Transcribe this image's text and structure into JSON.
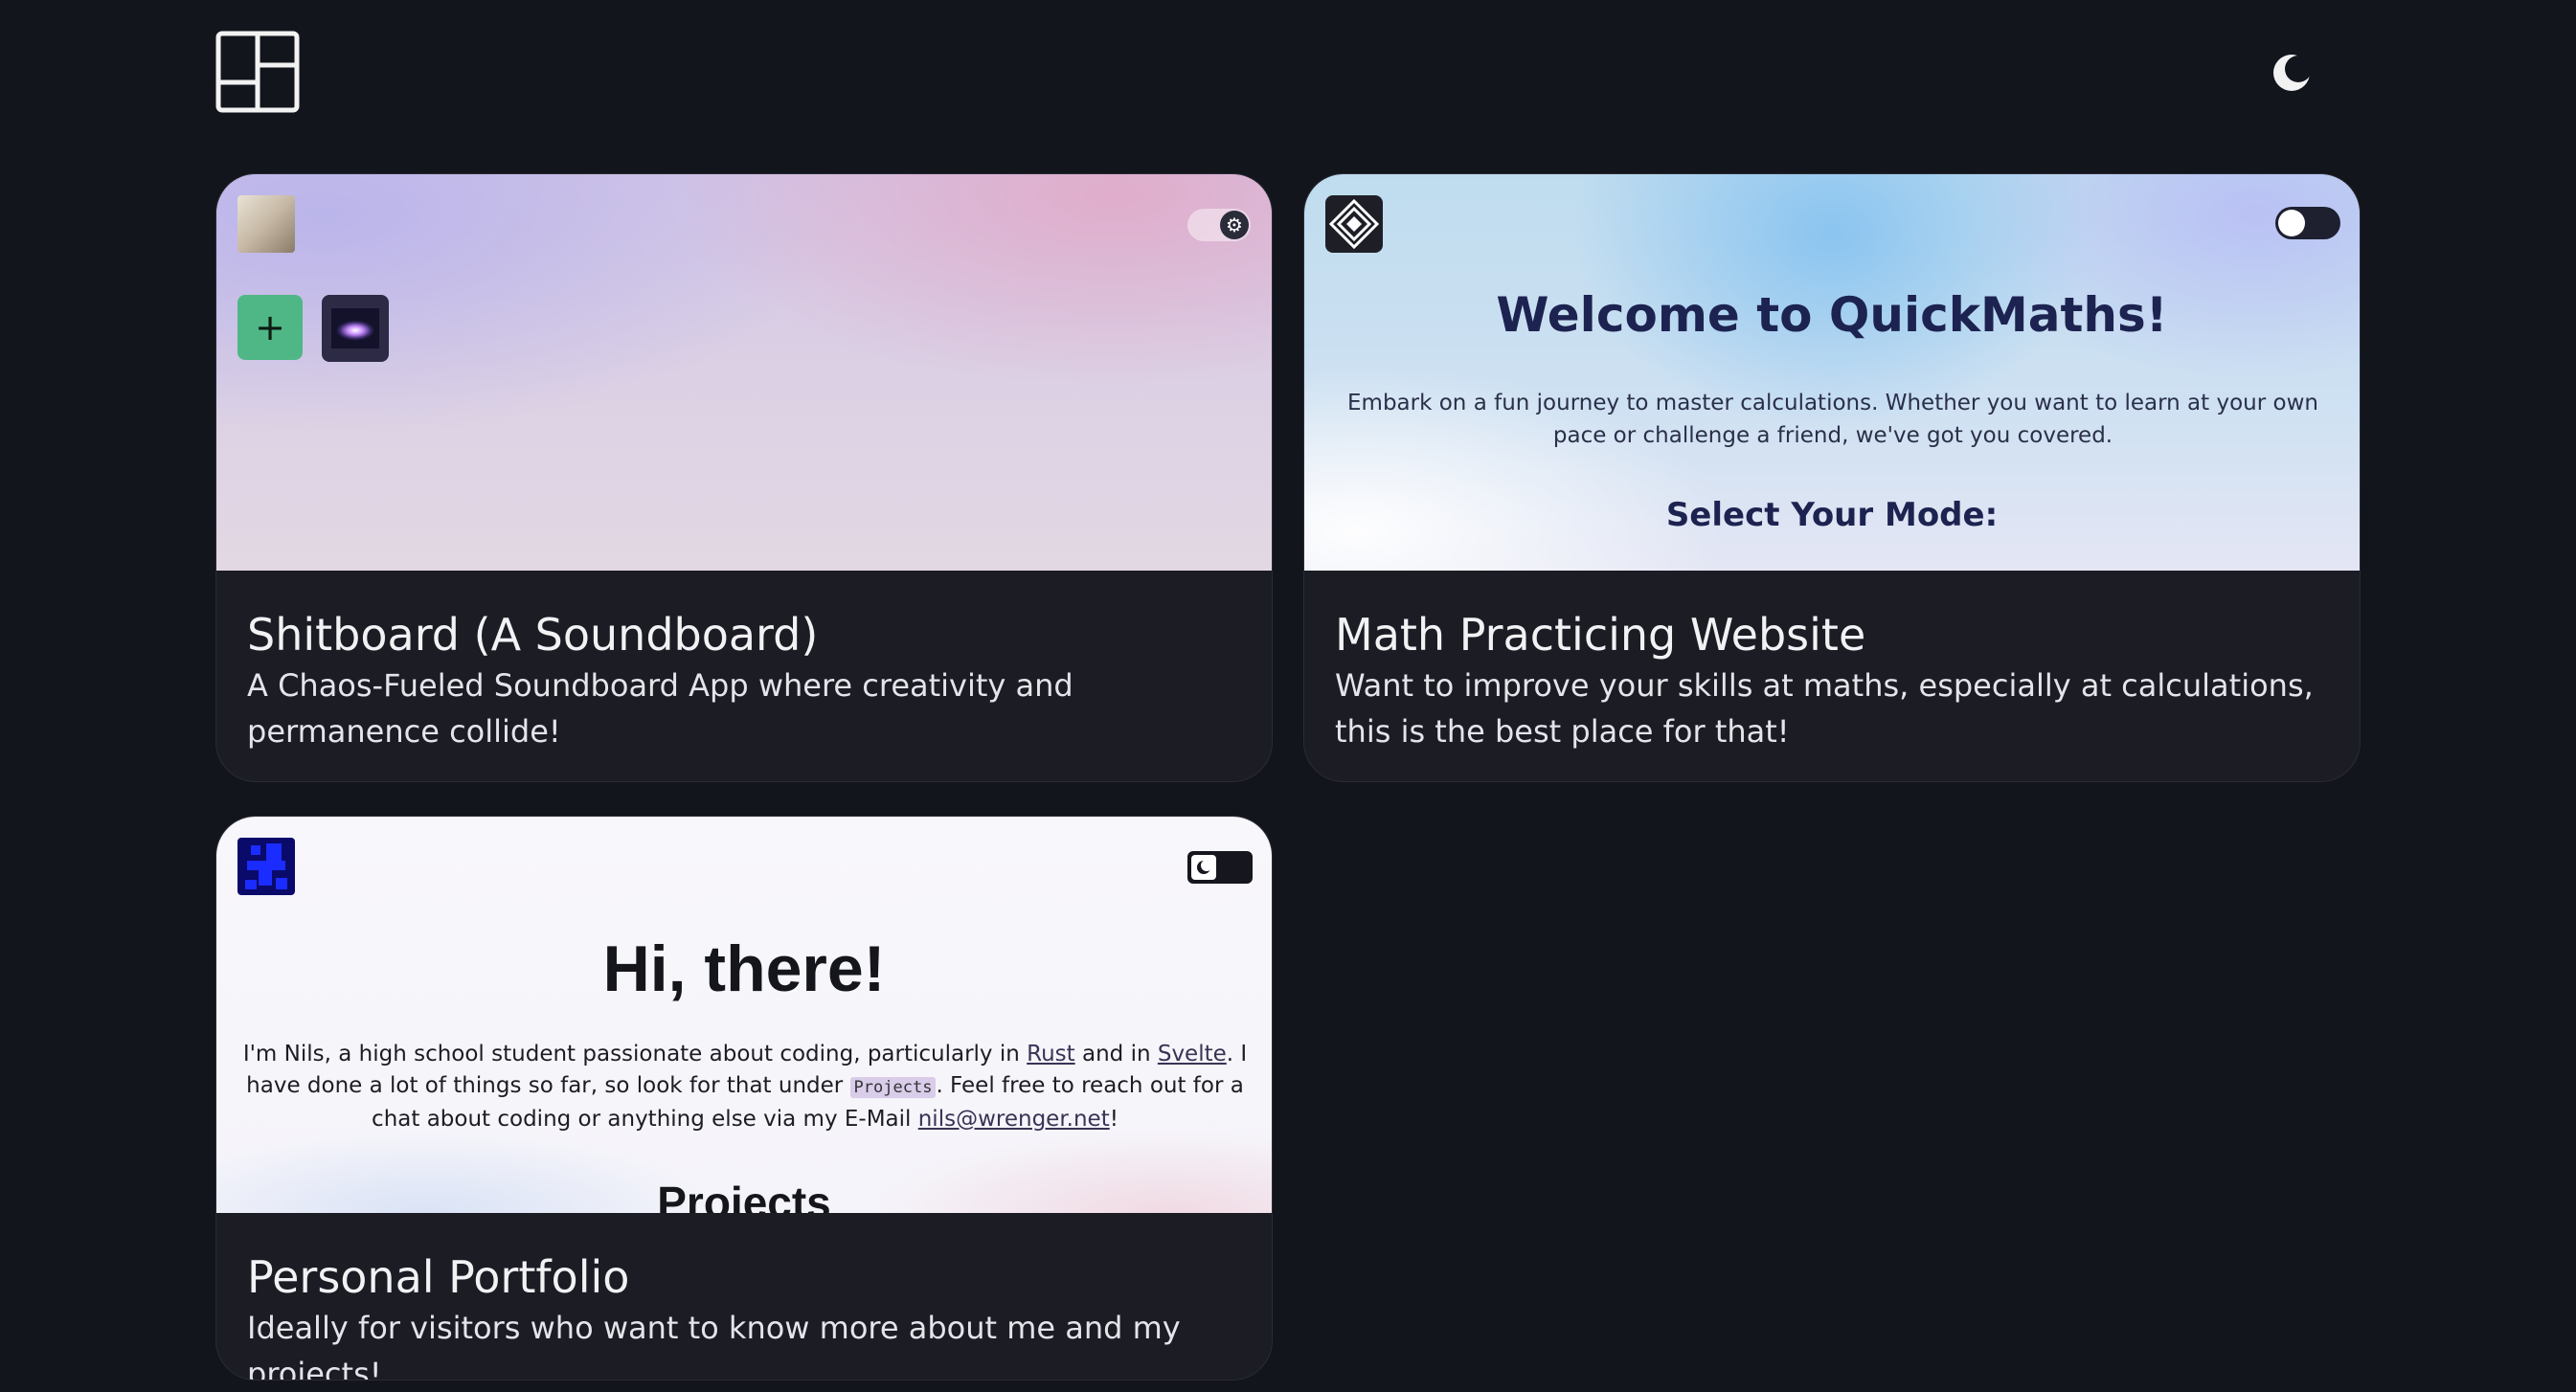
{
  "header": {
    "logo_icon": "dashboard-grid-icon",
    "theme_toggle_icon": "moon-icon"
  },
  "projects": [
    {
      "title": "Shitboard (A Soundboard)",
      "description": "A Chaos-Fueled Soundboard App where creativity and permanence collide!",
      "preview": {
        "add_button_label": "+",
        "toggle_icon": "gear-icon"
      }
    },
    {
      "title": "Math Practicing Website",
      "description": "Want to improve your skills at maths, especially at calculations, this is the best place for that!",
      "preview": {
        "heading": "Welcome to QuickMaths!",
        "text": "Embark on a fun journey to master calculations. Whether you want to learn at your own pace or challenge a friend, we've got you covered.",
        "subheading": "Select Your Mode:"
      }
    },
    {
      "title": "Personal Portfolio",
      "description": "Ideally for visitors who want to know more about me and my projects!",
      "preview": {
        "heading": "Hi, there!",
        "text_1": "I'm Nils, a high school student passionate about coding, particularly in ",
        "link_rust": "Rust",
        "text_2": " and in ",
        "link_svelte": "Svelte",
        "text_3": ". I have done a lot of things so far, so look for that under ",
        "code_projects": "Projects",
        "text_4": ". Feel free to reach out for a chat about coding or anything else via my E-Mail ",
        "link_email": "nils@wrenger.net",
        "text_5": "!",
        "section_heading": "Projects",
        "toggle_icon": "moon-icon"
      }
    }
  ],
  "colors": {
    "background": "#13151c",
    "card": "#1b1c24",
    "accent_green": "#4fb786",
    "heading_navy": "#1d2350"
  }
}
